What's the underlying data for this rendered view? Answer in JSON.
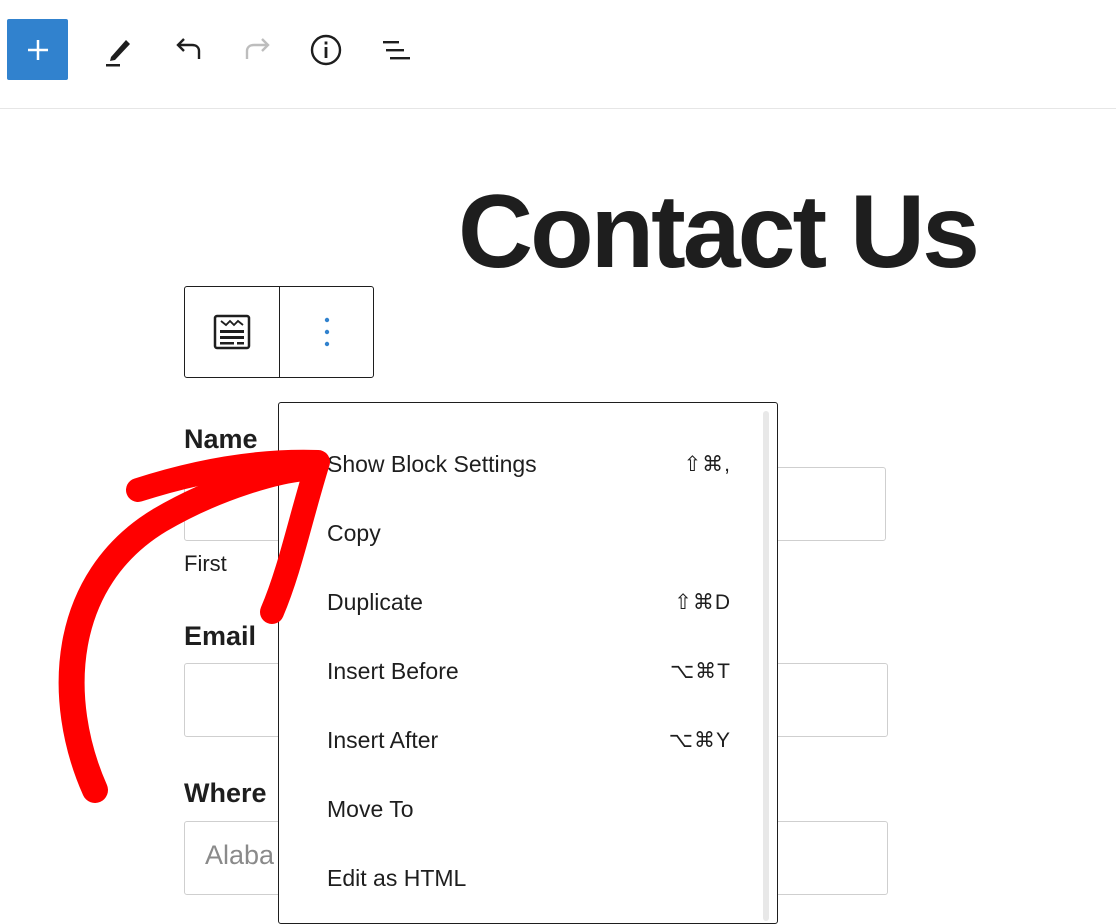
{
  "toolbar": {
    "icons": [
      "plus-icon",
      "pencil-icon",
      "undo-icon",
      "redo-icon",
      "info-icon",
      "list-view-icon"
    ]
  },
  "page": {
    "title": "Contact Us"
  },
  "form": {
    "name_label": "Name",
    "name_sub_first": "First",
    "email_label": "Email",
    "where_label": "Where",
    "where_placeholder": "Alaba"
  },
  "menu": {
    "items": [
      {
        "label": "Show Block Settings",
        "shortcut": "⇧⌘,"
      },
      {
        "label": "Copy",
        "shortcut": ""
      },
      {
        "label": "Duplicate",
        "shortcut": "⇧⌘D"
      },
      {
        "label": "Insert Before",
        "shortcut": "⌥⌘T"
      },
      {
        "label": "Insert After",
        "shortcut": "⌥⌘Y"
      },
      {
        "label": "Move To",
        "shortcut": ""
      },
      {
        "label": "Edit as HTML",
        "shortcut": ""
      }
    ]
  },
  "colors": {
    "accent": "#3182ce",
    "annotation": "#ff0000",
    "text": "#1e1e1e"
  }
}
